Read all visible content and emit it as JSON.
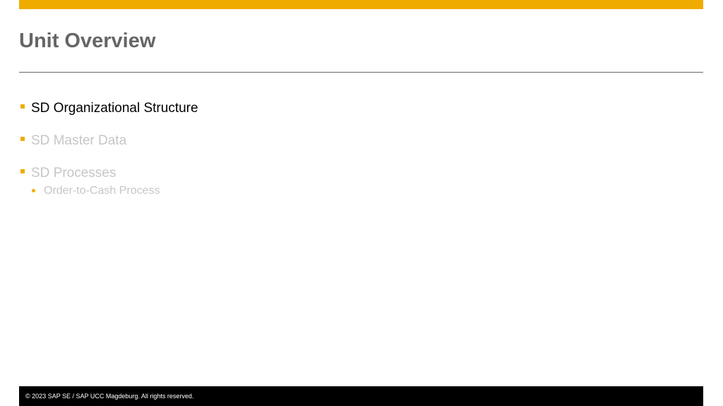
{
  "slide": {
    "title": "Unit Overview",
    "items": [
      {
        "label": "SD Organizational Structure",
        "state": "active"
      },
      {
        "label": "SD Master Data",
        "state": "dimmed"
      },
      {
        "label": "SD Processes",
        "state": "dimmed",
        "subitems": [
          "Order-to-Cash Process"
        ]
      }
    ],
    "footer": "© 2023 SAP SE / SAP UCC Magdeburg. All rights reserved."
  },
  "colors": {
    "accent": "#f0ab00",
    "title": "#666666",
    "active_text": "#000000",
    "dimmed_text": "#c6c6c6",
    "footer_bg": "#000000"
  }
}
